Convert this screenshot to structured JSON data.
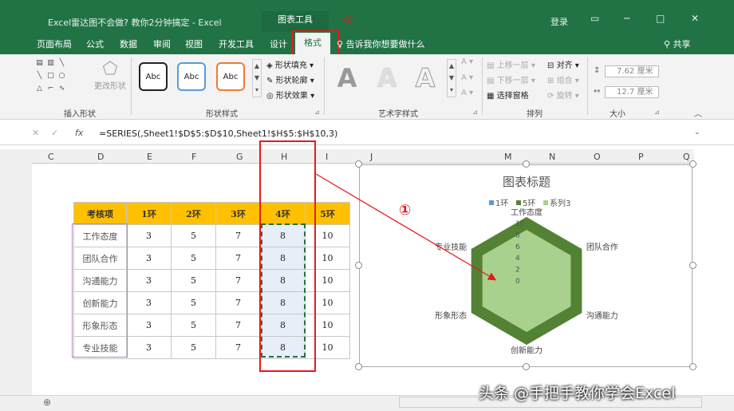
{
  "window": {
    "title": "Excel雷达图不会做? 教你2分钟搞定 - Excel",
    "context_title": "图表工具",
    "login": "登录",
    "min": "▭",
    "restore": "─",
    "max": "□",
    "close": "✕"
  },
  "tabs": [
    "页面布局",
    "公式",
    "数据",
    "审阅",
    "视图",
    "开发工具",
    "设计"
  ],
  "active_tab": "格式",
  "tell_me": "告诉我你想要做什么",
  "share": "共享",
  "annotations": {
    "circle_2": "②",
    "circle_1": "①"
  },
  "ribbon": {
    "insert_shapes_label": "插入形状",
    "change_shape": "更改形状",
    "shape_styles_label": "形状样式",
    "abc": "Abc",
    "shape_fill": "形状填充",
    "shape_outline": "形状轮廓",
    "shape_effects": "形状效果",
    "wordart_label": "艺术字样式",
    "wordart_a": "A",
    "arrange_label": "排列",
    "bring_forward": "上移一层",
    "send_backward": "下移一层",
    "selection_pane": "选择窗格",
    "align": "对齐",
    "group": "组合",
    "rotate": "旋转",
    "size_label": "大小",
    "height": "7.62 厘米",
    "width": "12.7 厘米"
  },
  "formula_bar": {
    "fx": "fx",
    "formula": "=SERIES(,Sheet1!$D$5:$D$10,Sheet1!$H$5:$H$10,3)"
  },
  "columns": [
    "C",
    "D",
    "E",
    "F",
    "G",
    "H",
    "I",
    "J",
    "M",
    "N",
    "O",
    "P",
    "Q"
  ],
  "table": {
    "headers": [
      "考核项",
      "1环",
      "2环",
      "3环",
      "4环",
      "5环"
    ],
    "rows": [
      [
        "工作态度",
        "3",
        "5",
        "7",
        "8",
        "10"
      ],
      [
        "团队合作",
        "3",
        "5",
        "7",
        "8",
        "10"
      ],
      [
        "沟通能力",
        "3",
        "5",
        "7",
        "8",
        "10"
      ],
      [
        "创新能力",
        "3",
        "5",
        "7",
        "8",
        "10"
      ],
      [
        "形象形态",
        "3",
        "5",
        "7",
        "8",
        "10"
      ],
      [
        "专业技能",
        "3",
        "5",
        "7",
        "8",
        "10"
      ]
    ]
  },
  "chart_data": {
    "type": "radar",
    "title": "图表标题",
    "categories": [
      "工作态度",
      "团队合作",
      "沟通能力",
      "创新能力",
      "形象形态",
      "专业技能"
    ],
    "series": [
      {
        "name": "1环",
        "values": [
          3,
          3,
          3,
          3,
          3,
          3
        ],
        "color": "#5b9bd5"
      },
      {
        "name": "5环",
        "values": [
          10,
          10,
          10,
          10,
          10,
          10
        ],
        "color": "#548235"
      },
      {
        "name": "系列3",
        "values": [
          8,
          8,
          8,
          8,
          8,
          8
        ],
        "color": "#a9d18e"
      }
    ],
    "axis_ticks": [
      "0",
      "2",
      "4",
      "6",
      "8",
      "10"
    ],
    "ylim": [
      0,
      10
    ],
    "legend": "top"
  },
  "watermark": "头条 @手把手教你学会Excel"
}
